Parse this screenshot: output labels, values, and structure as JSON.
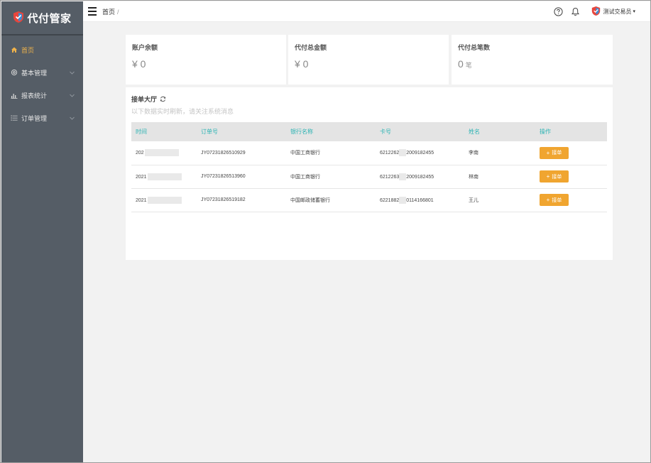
{
  "app": {
    "title": "代付管家"
  },
  "sidebar": {
    "items": [
      {
        "label": "首页",
        "icon": "home-icon",
        "active": true
      },
      {
        "label": "基本管理",
        "icon": "settings-icon",
        "active": false
      },
      {
        "label": "报表统计",
        "icon": "bar-chart-icon",
        "active": false
      },
      {
        "label": "订单管理",
        "icon": "list-icon",
        "active": false
      }
    ]
  },
  "header": {
    "breadcrumb": "首页",
    "breadcrumb_sep": "/",
    "user": "测试交易员"
  },
  "stats": [
    {
      "title": "账户余额",
      "value": "¥ 0",
      "unit": ""
    },
    {
      "title": "代付总金额",
      "value": "¥ 0",
      "unit": ""
    },
    {
      "title": "代付总笔数",
      "value": "0",
      "unit": "笔"
    }
  ],
  "hall": {
    "title": "接单大厅",
    "subtitle": "以下数据实时刷新，请关注系统消息",
    "columns": [
      "时间",
      "订单号",
      "银行名称",
      "卡号",
      "姓名",
      "操作"
    ],
    "rows": [
      {
        "time": "202",
        "order": "JY07231826510929",
        "bank": "中国工商银行",
        "card_a": "6212262",
        "card_b": "2009182455",
        "name": "李南"
      },
      {
        "time": "2021",
        "order": "JY07231826513960",
        "bank": "中国工商银行",
        "card_a": "6212263",
        "card_b": "2009182455",
        "name": "林南"
      },
      {
        "time": "2021",
        "order": "JY07231826519182",
        "bank": "中国邮政储蓄银行",
        "card_a": "6221882",
        "card_b": "0114166801",
        "name": "王儿"
      }
    ],
    "action_label": "接单"
  },
  "colors": {
    "sidebar_bg": "#555d66",
    "accent": "#f0b34a",
    "button": "#f0a530",
    "table_header_text": "#2bb3b3"
  }
}
